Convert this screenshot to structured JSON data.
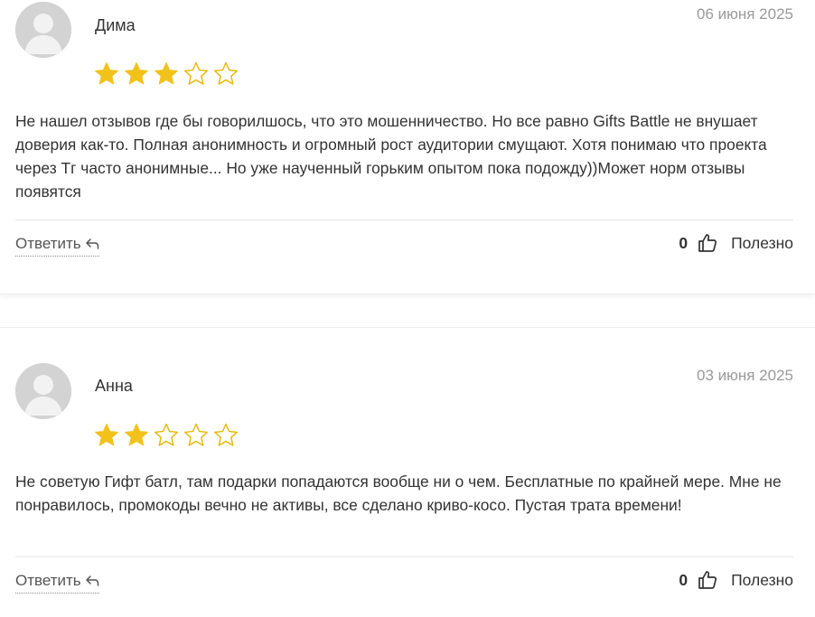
{
  "reviews": [
    {
      "author": "Дима",
      "date": "06 июня 2025",
      "rating": 3,
      "max_rating": 5,
      "text": "Не нашел отзывов где бы говорилшось, что это мошенничество. Но все равно Gifts Battle не внушает доверия как-то. Полная анонимность и огромный рост аудитории смущают. Хотя понимаю что проекта через Тг часто анонимные... Но уже наученный горьким опытом пока подожду))Может норм отзывы появятся",
      "reply_label": "Ответить",
      "likes": "0",
      "helpful_label": "Полезно"
    },
    {
      "author": "Анна",
      "date": "03 июня 2025",
      "rating": 2,
      "max_rating": 5,
      "text": "Не советую Гифт батл, там подарки попадаются вообще ни о чем. Бесплатные по крайней мере. Мне не понравилось, промокоды вечно не активы, все сделано криво-косо. Пустая трата времени!",
      "reply_label": "Ответить",
      "likes": "0",
      "helpful_label": "Полезно"
    }
  ],
  "colors": {
    "star_filled": "#f2c21b",
    "star_outline": "#e8b600",
    "avatar_bg": "#d3d3d3",
    "date_text": "#9a9a9a"
  },
  "icons": {
    "avatar": "user-silhouette-icon",
    "star": "star-icon",
    "reply": "reply-arrow-icon",
    "like": "thumbs-up-icon"
  }
}
